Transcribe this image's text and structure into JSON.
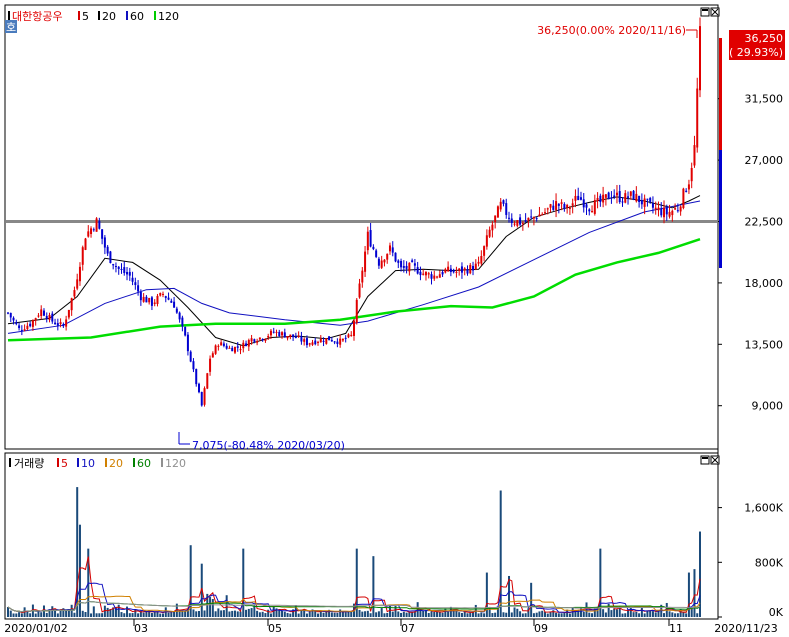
{
  "price_panel": {
    "stock_name": "대한항공우",
    "ma_legend": [
      {
        "label": "5",
        "color": "#d40000"
      },
      {
        "label": "20",
        "color": "#000000"
      },
      {
        "label": "60",
        "color": "#1010c0"
      },
      {
        "label": "120",
        "color": "#00cc00"
      }
    ],
    "corner_badge": "호",
    "high_annotation": "36,250(0.00% 2020/11/16)",
    "low_annotation": "7,075(-80.48% 2020/03/20)",
    "current_price": "36,250",
    "current_change": "( 29.93%)"
  },
  "volume_panel": {
    "title": "거래량",
    "ma_legend": [
      {
        "label": "5",
        "color": "#d40000"
      },
      {
        "label": "10",
        "color": "#1010c0"
      },
      {
        "label": "20",
        "color": "#d08000"
      },
      {
        "label": "60",
        "color": "#008000"
      },
      {
        "label": "120",
        "color": "#909090"
      }
    ]
  },
  "colors": {
    "up": "#e00000",
    "down": "#0000d0",
    "ma5": "#d40000",
    "ma20": "#000000",
    "ma60": "#1010c0",
    "ma120": "#00dd00",
    "volume_bar": "#1a4a7a",
    "support_line": "#888888"
  },
  "chart_data": {
    "type": "candlestick",
    "x_tick_labels": [
      "2020/01/02",
      "03",
      "05",
      "07",
      "09",
      "11",
      "2020/11/23"
    ],
    "price_axis": {
      "ticks": [
        9000,
        13500,
        18000,
        22500,
        27000,
        31500
      ],
      "tick_labels": [
        "9,000",
        "13,500",
        "18,000",
        "22,500",
        "27,000",
        "31,500"
      ],
      "range": [
        5900,
        38000
      ]
    },
    "volume_axis": {
      "ticks": [
        0,
        800000,
        1600000
      ],
      "tick_labels": [
        "0K",
        "800K",
        "1,600K"
      ],
      "range": [
        0,
        2150000
      ]
    },
    "support_level": 22500,
    "price_path": [
      [
        0,
        15800
      ],
      [
        4,
        14600
      ],
      [
        8,
        15000
      ],
      [
        12,
        16000
      ],
      [
        16,
        15200
      ],
      [
        20,
        14800
      ],
      [
        24,
        17500
      ],
      [
        28,
        21500
      ],
      [
        32,
        22500
      ],
      [
        36,
        20000
      ],
      [
        40,
        19000
      ],
      [
        44,
        18500
      ],
      [
        48,
        17000
      ],
      [
        52,
        16500
      ],
      [
        56,
        17200
      ],
      [
        60,
        16400
      ],
      [
        64,
        14000
      ],
      [
        67,
        11500
      ],
      [
        70,
        9000
      ],
      [
        73,
        12500
      ],
      [
        76,
        13600
      ],
      [
        80,
        13200
      ],
      [
        84,
        13300
      ],
      [
        88,
        13900
      ],
      [
        92,
        14000
      ],
      [
        96,
        14400
      ],
      [
        100,
        14200
      ],
      [
        104,
        14000
      ],
      [
        108,
        13600
      ],
      [
        112,
        13800
      ],
      [
        116,
        13900
      ],
      [
        120,
        13700
      ],
      [
        124,
        14100
      ],
      [
        126,
        16500
      ],
      [
        130,
        21500
      ],
      [
        134,
        19500
      ],
      [
        138,
        20500
      ],
      [
        142,
        19000
      ],
      [
        146,
        19200
      ],
      [
        150,
        18700
      ],
      [
        154,
        18500
      ],
      [
        158,
        18900
      ],
      [
        162,
        18800
      ],
      [
        166,
        19000
      ],
      [
        170,
        19300
      ],
      [
        174,
        21800
      ],
      [
        178,
        23700
      ],
      [
        182,
        22600
      ],
      [
        186,
        22400
      ],
      [
        190,
        22800
      ],
      [
        194,
        23200
      ],
      [
        198,
        23800
      ],
      [
        202,
        23400
      ],
      [
        206,
        24300
      ],
      [
        210,
        23600
      ],
      [
        214,
        23900
      ],
      [
        218,
        24500
      ],
      [
        222,
        24200
      ],
      [
        226,
        24400
      ],
      [
        230,
        23800
      ],
      [
        234,
        23400
      ],
      [
        238,
        23100
      ],
      [
        242,
        23500
      ],
      [
        246,
        25500
      ],
      [
        248,
        27900
      ],
      [
        250,
        36250
      ]
    ],
    "ma_series": [
      {
        "name": "20",
        "color": "#000000",
        "values": [
          [
            0,
            15000
          ],
          [
            15,
            15400
          ],
          [
            25,
            17000
          ],
          [
            35,
            19800
          ],
          [
            45,
            19500
          ],
          [
            55,
            18200
          ],
          [
            65,
            16200
          ],
          [
            75,
            14000
          ],
          [
            85,
            13400
          ],
          [
            95,
            14000
          ],
          [
            105,
            14100
          ],
          [
            115,
            13900
          ],
          [
            122,
            14300
          ],
          [
            130,
            17000
          ],
          [
            140,
            18900
          ],
          [
            150,
            19000
          ],
          [
            160,
            18900
          ],
          [
            170,
            19000
          ],
          [
            180,
            21400
          ],
          [
            190,
            22800
          ],
          [
            200,
            23400
          ],
          [
            210,
            23900
          ],
          [
            220,
            24300
          ],
          [
            230,
            24000
          ],
          [
            240,
            23500
          ],
          [
            246,
            24000
          ],
          [
            250,
            24400
          ]
        ]
      },
      {
        "name": "60",
        "color": "#1010c0",
        "values": [
          [
            0,
            14300
          ],
          [
            20,
            14900
          ],
          [
            35,
            16500
          ],
          [
            50,
            17500
          ],
          [
            60,
            17600
          ],
          [
            70,
            16500
          ],
          [
            80,
            15800
          ],
          [
            100,
            15300
          ],
          [
            120,
            14900
          ],
          [
            130,
            15200
          ],
          [
            150,
            16400
          ],
          [
            170,
            17700
          ],
          [
            190,
            19700
          ],
          [
            210,
            21700
          ],
          [
            230,
            23200
          ],
          [
            240,
            23600
          ],
          [
            250,
            24000
          ]
        ]
      },
      {
        "name": "120",
        "color": "#00dd00",
        "values": [
          [
            0,
            13800
          ],
          [
            30,
            14000
          ],
          [
            55,
            14800
          ],
          [
            75,
            15000
          ],
          [
            100,
            15000
          ],
          [
            120,
            15300
          ],
          [
            140,
            15900
          ],
          [
            160,
            16300
          ],
          [
            175,
            16200
          ],
          [
            190,
            17000
          ],
          [
            205,
            18600
          ],
          [
            220,
            19500
          ],
          [
            235,
            20200
          ],
          [
            250,
            21200
          ]
        ]
      }
    ],
    "volume_spikes": [
      [
        25,
        1900000
      ],
      [
        26,
        1350000
      ],
      [
        29,
        1000000
      ],
      [
        66,
        1050000
      ],
      [
        70,
        780000
      ],
      [
        85,
        1000000
      ],
      [
        126,
        1000000
      ],
      [
        132,
        890000
      ],
      [
        173,
        650000
      ],
      [
        178,
        1850000
      ],
      [
        181,
        600000
      ],
      [
        189,
        500000
      ],
      [
        214,
        1000000
      ],
      [
        246,
        650000
      ],
      [
        248,
        700000
      ],
      [
        250,
        1250000
      ]
    ]
  }
}
